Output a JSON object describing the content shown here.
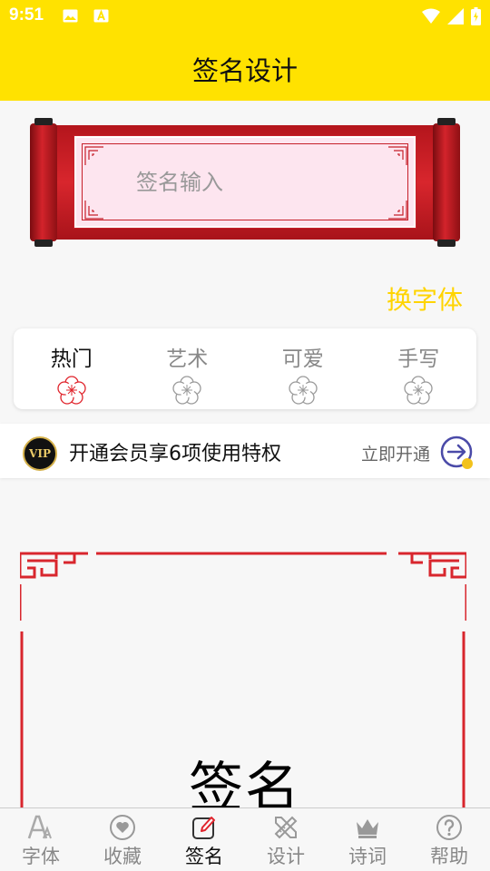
{
  "status_bar": {
    "time": "9:51",
    "left_icons": [
      "image-icon",
      "text-a-icon"
    ],
    "right_icons": [
      "wifi-icon",
      "signal-icon",
      "battery-charging-icon"
    ]
  },
  "header": {
    "title": "签名设计",
    "background": "#ffe200"
  },
  "signature_input": {
    "placeholder": "签名输入",
    "value": ""
  },
  "switch_font_label": "换字体",
  "categories": [
    {
      "label": "热门",
      "active": true,
      "icon": "flower-icon",
      "icon_color": "#e0242c"
    },
    {
      "label": "艺术",
      "active": false,
      "icon": "flower-icon",
      "icon_color": "#9a9a9a"
    },
    {
      "label": "可爱",
      "active": false,
      "icon": "flower-icon",
      "icon_color": "#9a9a9a"
    },
    {
      "label": "手写",
      "active": false,
      "icon": "flower-icon",
      "icon_color": "#9a9a9a"
    }
  ],
  "vip_banner": {
    "badge": "VIP",
    "text": "开通会员享6项使用特权",
    "action": "立即开通",
    "action_icon": "arrow-right-circle-icon"
  },
  "preview": {
    "text": "签名",
    "frame_color": "#d8262d"
  },
  "bottom_nav": [
    {
      "label": "字体",
      "icon": "font-icon",
      "active": false
    },
    {
      "label": "收藏",
      "icon": "heart-icon",
      "active": false
    },
    {
      "label": "签名",
      "icon": "pen-edit-icon",
      "active": true
    },
    {
      "label": "设计",
      "icon": "ruler-pencil-icon",
      "active": false
    },
    {
      "label": "诗词",
      "icon": "crown-icon",
      "active": false
    },
    {
      "label": "帮助",
      "icon": "help-icon",
      "active": false
    }
  ],
  "colors": {
    "accent": "#ffd400",
    "scroll_red": "#d3232b",
    "paper_pink": "#fde5ef"
  }
}
